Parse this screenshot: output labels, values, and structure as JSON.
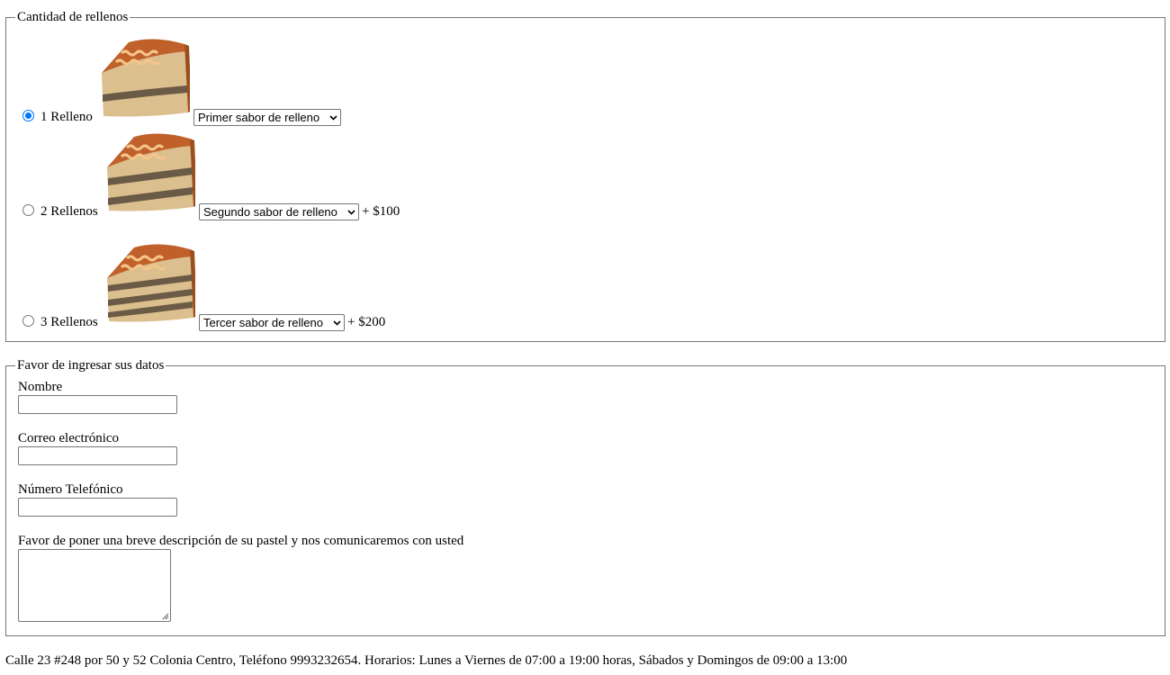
{
  "fillings_section": {
    "legend": "Cantidad de rellenos",
    "options": [
      {
        "label": "1 Relleno",
        "checked": true,
        "select": "Primer sabor de relleno",
        "price": "",
        "layers": 1
      },
      {
        "label": "2 Rellenos",
        "checked": false,
        "select": "Segundo sabor de relleno",
        "price": "+ $100",
        "layers": 2
      },
      {
        "label": "3 Rellenos",
        "checked": false,
        "select": "Tercer sabor de relleno",
        "price": "+ $200",
        "layers": 3
      }
    ]
  },
  "data_section": {
    "legend": "Favor de ingresar sus datos",
    "name_label": "Nombre",
    "name_value": "",
    "email_label": "Correo electrónico",
    "email_value": "",
    "phone_label": "Número Telefónico",
    "phone_value": "",
    "description_label": "Favor de poner una breve descripción de su pastel y nos comunicaremos con usted",
    "description_value": ""
  },
  "footer": {
    "text": "Calle 23 #248 por 50 y 52 Colonia Centro, Teléfono 9993232654. Horarios: Lunes a Viernes de 07:00 a 19:00 horas, Sábados y Domingos de 09:00 a 13:00"
  },
  "colors": {
    "accent": "#0075ff",
    "border": "#767676",
    "cake_top": "#c0612b",
    "cake_cream": "#f5c58a",
    "cake_sponge": "#dcbf8e",
    "cake_filling": "#6b5a45",
    "cake_side": "#9c4e1c"
  }
}
